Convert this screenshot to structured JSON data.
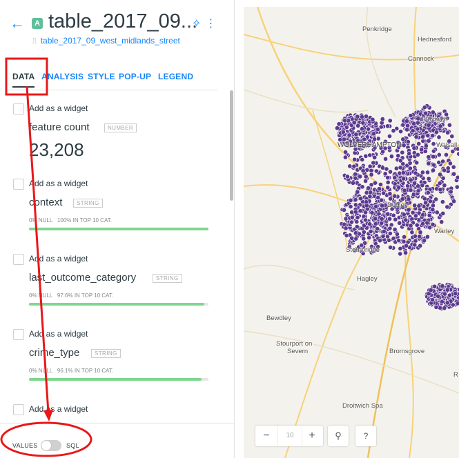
{
  "header": {
    "back_icon": "arrow-left-icon",
    "badge_letter": "A",
    "title": "table_2017_09...",
    "subtitle": "table_2017_09_west_midlands_street",
    "link_icon": "link-icon"
  },
  "tabs": [
    {
      "label": "DATA",
      "active": true
    },
    {
      "label": "ANALYSIS"
    },
    {
      "label": "STYLE"
    },
    {
      "label": "POP-UP"
    },
    {
      "label": "LEGEND"
    }
  ],
  "widgets": [
    {
      "add_label": "Add as a widget",
      "name": "feature count",
      "type": "NUMBER",
      "value": "23,208"
    },
    {
      "add_label": "Add as a widget",
      "name": "context",
      "type": "STRING",
      "null_pct": "0% NULL",
      "top": "100% IN TOP 10 CAT.",
      "fill": 1.0
    },
    {
      "add_label": "Add as a widget",
      "name": "last_outcome_category",
      "type": "STRING",
      "null_pct": "0% NULL",
      "top": "97.6% IN TOP 10 CAT.",
      "fill": 0.976
    },
    {
      "add_label": "Add as a widget",
      "name": "crime_type",
      "type": "STRING",
      "null_pct": "0% NULL",
      "top": "96.1% IN TOP 10 CAT.",
      "fill": 0.961
    },
    {
      "add_label": "Add as a widget"
    }
  ],
  "footer": {
    "values_label": "VALUES",
    "sql_label": "SQL",
    "sql_on": false
  },
  "map": {
    "labels": [
      "Penkridge",
      "Hednesford",
      "Cannock",
      "Bloxwich",
      "WOLVERHAMPTON",
      "Walsall",
      "Dudley",
      "Stourbridge",
      "Warley",
      "Hagley",
      "Bewdley",
      "Stourport on",
      "Severn",
      "Bromsgrove",
      "Droitwich Spa",
      "R"
    ],
    "zoom": "10",
    "zoom_out_icon": "minus-icon",
    "zoom_in_icon": "plus-icon",
    "search_icon": "search-icon",
    "help_label": "?",
    "point_color": "#5b3a8e"
  },
  "colors": {
    "accent": "#1785fb",
    "annotation": "#e81818",
    "success": "#7ed68f"
  }
}
